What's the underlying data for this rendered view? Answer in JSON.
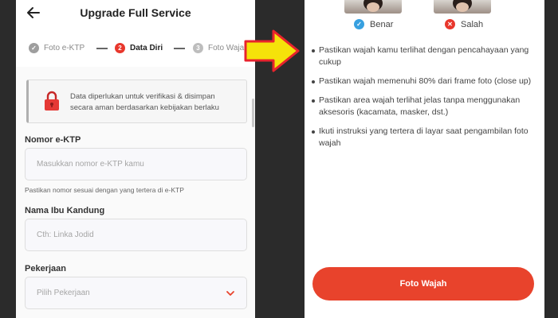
{
  "left": {
    "header": {
      "title": "Upgrade Full Service"
    },
    "steps": [
      {
        "number": "1",
        "label": "Foto e-KTP",
        "state": "done"
      },
      {
        "number": "2",
        "label": "Data Diri",
        "state": "active"
      },
      {
        "number": "3",
        "label": "Foto Wajah",
        "state": "todo"
      }
    ],
    "notice": {
      "text": "Data diperlukan untuk verifikasi & disimpan secara aman berdasarkan kebijakan berlaku"
    },
    "form": {
      "ktp": {
        "label": "Nomor e-KTP",
        "placeholder": "Masukkan nomor e-KTP kamu",
        "hint": "Pastikan nomor sesuai dengan yang tertera di e-KTP"
      },
      "mother": {
        "label": "Nama Ibu Kandung",
        "placeholder": "Cth: Linka Jodid"
      },
      "job": {
        "label": "Pekerjaan",
        "placeholder": "Pilih Pekerjaan"
      }
    }
  },
  "right": {
    "examples": {
      "correct_label": "Benar",
      "wrong_label": "Salah"
    },
    "tips": [
      "Pastikan wajah kamu terlihat dengan pencahayaan yang cukup",
      "Pastikan wajah memenuhi 80% dari frame foto (close up)",
      "Pastikan area wajah terlihat jelas tanpa menggunakan aksesoris (kacamata, masker, dst.)",
      "Ikuti instruksi yang tertera di layar saat pengambilan foto wajah"
    ],
    "button_label": "Foto Wajah"
  },
  "colors": {
    "accent": "#e8432c",
    "arrow_fill": "#f5e20a",
    "arrow_stroke": "#e8232c",
    "correct_badge": "#37a0e0"
  }
}
